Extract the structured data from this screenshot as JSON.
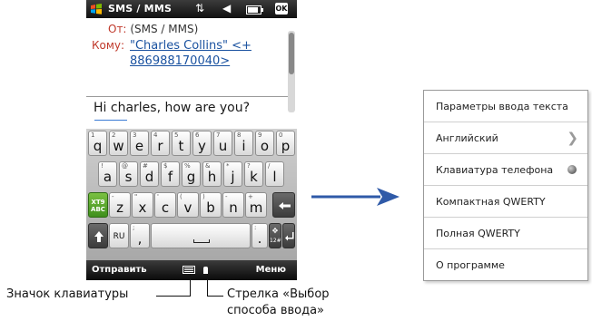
{
  "phone": {
    "status_title": "SMS / MMS",
    "status_ok": "OK",
    "from_label": "От:",
    "from_value": "(SMS / MMS)",
    "to_label": "Кому:",
    "to_line1": "\"Charles Collins\" <+",
    "to_line2": "886988170040>",
    "message_body": "Hi charles,  how are you?"
  },
  "keyboard": {
    "row1": [
      {
        "ch": "q",
        "sym": "1"
      },
      {
        "ch": "w",
        "sym": "2"
      },
      {
        "ch": "e",
        "sym": "3"
      },
      {
        "ch": "r",
        "sym": "4"
      },
      {
        "ch": "t",
        "sym": "5"
      },
      {
        "ch": "y",
        "sym": "6"
      },
      {
        "ch": "u",
        "sym": "7"
      },
      {
        "ch": "i",
        "sym": "8"
      },
      {
        "ch": "o",
        "sym": "9"
      },
      {
        "ch": "p",
        "sym": "0"
      }
    ],
    "row2": [
      {
        "ch": "a",
        "sym": "!"
      },
      {
        "ch": "s",
        "sym": "@"
      },
      {
        "ch": "d",
        "sym": "#"
      },
      {
        "ch": "f",
        "sym": "$"
      },
      {
        "ch": "g",
        "sym": "%"
      },
      {
        "ch": "h",
        "sym": "&"
      },
      {
        "ch": "j",
        "sym": "*"
      },
      {
        "ch": "k",
        "sym": "?"
      },
      {
        "ch": "l",
        "sym": "/"
      }
    ],
    "xt9_label": "XT9\nABC",
    "row3": [
      {
        "ch": "z",
        "sym": "-"
      },
      {
        "ch": "x",
        "sym": "\""
      },
      {
        "ch": "c",
        "sym": "'"
      },
      {
        "ch": "v",
        "sym": "("
      },
      {
        "ch": "b",
        "sym": ")"
      },
      {
        "ch": "n",
        "sym": "-"
      },
      {
        "ch": "m",
        "sym": "+"
      }
    ],
    "lang_key": "RU",
    "comma_key": ",",
    "semicolon_sym": ";",
    "period_key": ".",
    "colon_sym": ":",
    "numeric_key": "12#",
    "backspace_icon": "backspace-arrow-icon",
    "enter_icon": "enter-arrow-icon",
    "shift_icon": "shift-arrow-icon"
  },
  "softbar": {
    "left": "Отправить",
    "right": "Меню"
  },
  "annotations": {
    "keyboard_icon": "Значок клавиатуры",
    "ime_arrow_line1": "Стрелка «Выбор",
    "ime_arrow_line2": "способа ввода»"
  },
  "menu": {
    "items": [
      {
        "label": "Параметры ввода текста"
      },
      {
        "label": "Английский",
        "indicator": "chevron-right-icon"
      },
      {
        "label": "Клавиатура телефона",
        "indicator": "selected-radio-icon"
      },
      {
        "label": "Компактная QWERTY"
      },
      {
        "label": "Полная QWERTY"
      },
      {
        "label": "О программе"
      }
    ]
  },
  "colors": {
    "arrow": "#2f5aa8",
    "label_red": "#c0392b",
    "link_blue": "#1a52a0",
    "xt9_green": "#4f9e27"
  }
}
